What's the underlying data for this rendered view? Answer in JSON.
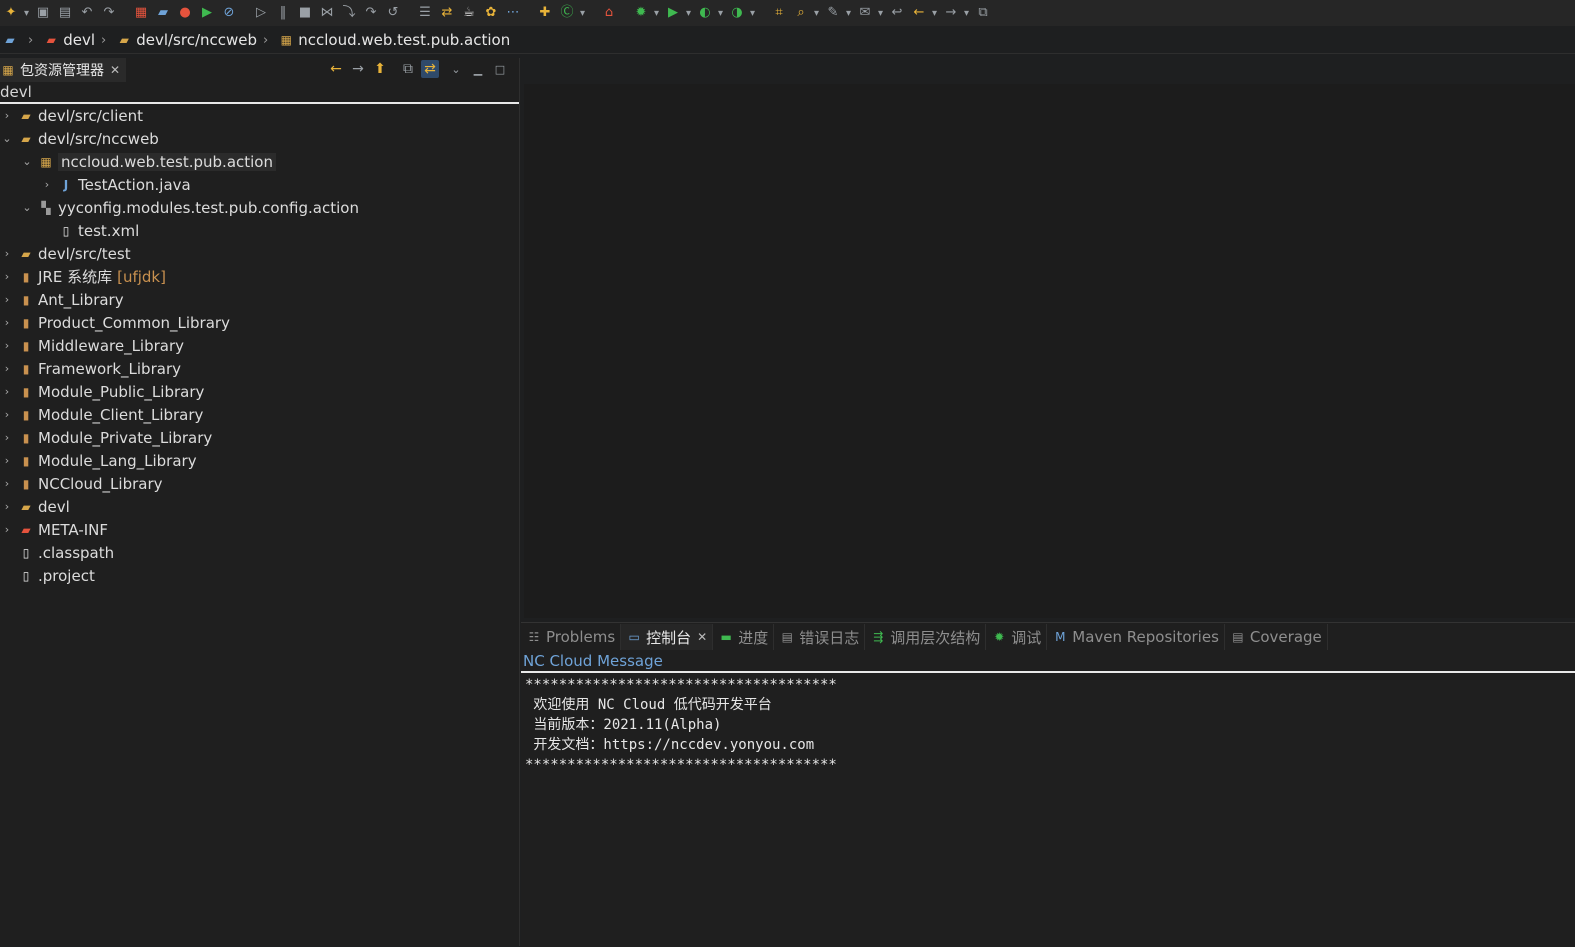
{
  "toolbar": {
    "icons": [
      {
        "name": "new-icon",
        "glyph": "✦",
        "dd": true
      },
      {
        "name": "save-icon",
        "glyph": "▣"
      },
      {
        "name": "save-all-icon",
        "glyph": "▤"
      },
      {
        "name": "undo-icon",
        "glyph": "↶"
      },
      {
        "name": "redo-icon",
        "glyph": "↷"
      },
      {
        "name": "apps-icon",
        "glyph": "▦"
      },
      {
        "name": "open-folder-icon",
        "glyph": "▰"
      },
      {
        "name": "stop-red-icon",
        "glyph": "●"
      },
      {
        "name": "run-server-icon",
        "glyph": "▶"
      },
      {
        "name": "skip-breakpoints-icon",
        "glyph": "⊘"
      },
      {
        "name": "resume-icon",
        "glyph": "▷"
      },
      {
        "name": "suspend-icon",
        "glyph": "‖"
      },
      {
        "name": "terminate-icon",
        "glyph": "■"
      },
      {
        "name": "disconnect-icon",
        "glyph": "⋈"
      },
      {
        "name": "step-into-icon",
        "glyph": "⤵"
      },
      {
        "name": "step-over-icon",
        "glyph": "↷"
      },
      {
        "name": "step-return-icon",
        "glyph": "↺"
      },
      {
        "name": "open-console-icon",
        "glyph": "☰"
      },
      {
        "name": "sync-icon",
        "glyph": "⇄"
      },
      {
        "name": "coffee-icon",
        "glyph": "☕"
      },
      {
        "name": "plugin-icon",
        "glyph": "✿"
      },
      {
        "name": "toggle-icon",
        "glyph": "⋯"
      },
      {
        "name": "new-java-package-icon",
        "glyph": "✚"
      },
      {
        "name": "new-class-icon",
        "glyph": "Ⓒ",
        "dd": true
      },
      {
        "name": "home-icon",
        "glyph": "⌂"
      },
      {
        "name": "debug-bug-icon",
        "glyph": "✹",
        "dd": true
      },
      {
        "name": "run-icon",
        "glyph": "▶",
        "dd": true
      },
      {
        "name": "coverage-icon",
        "glyph": "◐",
        "dd": true
      },
      {
        "name": "external-tools-icon",
        "glyph": "◑",
        "dd": true
      },
      {
        "name": "open-type-icon",
        "glyph": "⌗"
      },
      {
        "name": "search-icon",
        "glyph": "⌕",
        "dd": true
      },
      {
        "name": "annotation-icon",
        "glyph": "✎",
        "dd": true
      },
      {
        "name": "edit-history-icon",
        "glyph": "✉",
        "dd": true
      },
      {
        "name": "last-edit-icon",
        "glyph": "↩"
      },
      {
        "name": "back-arrow-icon",
        "glyph": "←",
        "dd": true
      },
      {
        "name": "forward-arrow-icon",
        "glyph": "→",
        "dd": true
      },
      {
        "name": "pin-editor-icon",
        "glyph": "⧉"
      }
    ]
  },
  "breadcrumb": {
    "items": [
      "devl",
      "devl/src/nccweb",
      "nccloud.web.test.pub.action"
    ]
  },
  "package_explorer": {
    "tab_label": "包资源管理器",
    "filter_text": "devl",
    "tree": [
      {
        "depth": 0,
        "twisty": "›",
        "icon": "source-folder-icon",
        "glyph": "▰",
        "label": "devl/src/client"
      },
      {
        "depth": 0,
        "twisty": "⌄",
        "icon": "source-folder-icon",
        "glyph": "▰",
        "label": "devl/src/nccweb"
      },
      {
        "depth": 1,
        "twisty": "⌄",
        "icon": "package-icon",
        "glyph": "▦",
        "label": "nccloud.web.test.pub.action",
        "selected": true
      },
      {
        "depth": 2,
        "twisty": "›",
        "icon": "java-file-icon",
        "glyph": "J",
        "label": "TestAction.java"
      },
      {
        "depth": 1,
        "twisty": "⌄",
        "icon": "empty-package-icon",
        "glyph": "▚",
        "label": "yyconfig.modules.test.pub.config.action"
      },
      {
        "depth": 2,
        "twisty": "",
        "icon": "xml-file-icon",
        "glyph": "▯",
        "label": "test.xml"
      },
      {
        "depth": 0,
        "twisty": "›",
        "icon": "source-folder-icon",
        "glyph": "▰",
        "label": "devl/src/test"
      },
      {
        "depth": 0,
        "twisty": "›",
        "icon": "library-icon",
        "glyph": "▮",
        "label": "JRE 系统库",
        "decor": "[ufjdk]"
      },
      {
        "depth": 0,
        "twisty": "›",
        "icon": "library-icon",
        "glyph": "▮",
        "label": "Ant_Library"
      },
      {
        "depth": 0,
        "twisty": "›",
        "icon": "library-icon",
        "glyph": "▮",
        "label": "Product_Common_Library"
      },
      {
        "depth": 0,
        "twisty": "›",
        "icon": "library-icon",
        "glyph": "▮",
        "label": "Middleware_Library"
      },
      {
        "depth": 0,
        "twisty": "›",
        "icon": "library-icon",
        "glyph": "▮",
        "label": "Framework_Library"
      },
      {
        "depth": 0,
        "twisty": "›",
        "icon": "library-icon",
        "glyph": "▮",
        "label": "Module_Public_Library"
      },
      {
        "depth": 0,
        "twisty": "›",
        "icon": "library-icon",
        "glyph": "▮",
        "label": "Module_Client_Library"
      },
      {
        "depth": 0,
        "twisty": "›",
        "icon": "library-icon",
        "glyph": "▮",
        "label": "Module_Private_Library"
      },
      {
        "depth": 0,
        "twisty": "›",
        "icon": "library-icon",
        "glyph": "▮",
        "label": "Module_Lang_Library"
      },
      {
        "depth": 0,
        "twisty": "›",
        "icon": "library-icon",
        "glyph": "▮",
        "label": "NCCloud_Library"
      },
      {
        "depth": 0,
        "twisty": "›",
        "icon": "folder-icon",
        "glyph": "▰",
        "label": "devl"
      },
      {
        "depth": 0,
        "twisty": "›",
        "icon": "error-folder-icon",
        "glyph": "▰",
        "label": "META-INF"
      },
      {
        "depth": 0,
        "twisty": "",
        "icon": "file-icon",
        "glyph": "▯",
        "label": ".classpath"
      },
      {
        "depth": 0,
        "twisty": "",
        "icon": "file-icon",
        "glyph": "▯",
        "label": ".project"
      }
    ]
  },
  "bottom_panel": {
    "tabs": [
      {
        "name": "tab-problems",
        "icon": "problems-icon",
        "glyph": "☷",
        "label": "Problems"
      },
      {
        "name": "tab-console",
        "icon": "console-icon",
        "glyph": "▭",
        "label": "控制台",
        "active": true
      },
      {
        "name": "tab-progress",
        "icon": "progress-icon",
        "glyph": "▬",
        "label": "进度"
      },
      {
        "name": "tab-error-log",
        "icon": "error-log-icon",
        "glyph": "▤",
        "label": "错误日志"
      },
      {
        "name": "tab-call-hierarchy",
        "icon": "call-hierarchy-icon",
        "glyph": "⇶",
        "label": "调用层次结构"
      },
      {
        "name": "tab-debug",
        "icon": "debug-icon",
        "glyph": "✹",
        "label": "调试"
      },
      {
        "name": "tab-maven",
        "icon": "maven-icon",
        "glyph": "M",
        "label": "Maven Repositories"
      },
      {
        "name": "tab-coverage",
        "icon": "coverage-report-icon",
        "glyph": "▤",
        "label": "Coverage"
      }
    ],
    "console_title": "NC Cloud Message",
    "console_lines": [
      "*************************************",
      " 欢迎使用 NC Cloud 低代码开发平台",
      " 当前版本：2021.11(Alpha)",
      " 开发文档：https://nccdev.yonyou.com",
      "*************************************"
    ]
  },
  "colors": {
    "background": "#1e1f20",
    "console_title": "#6fa3d8",
    "decoration": "#c9914f",
    "accent_yellow": "#e8b339",
    "accent_green": "#3fb950",
    "accent_red": "#e5533d"
  }
}
